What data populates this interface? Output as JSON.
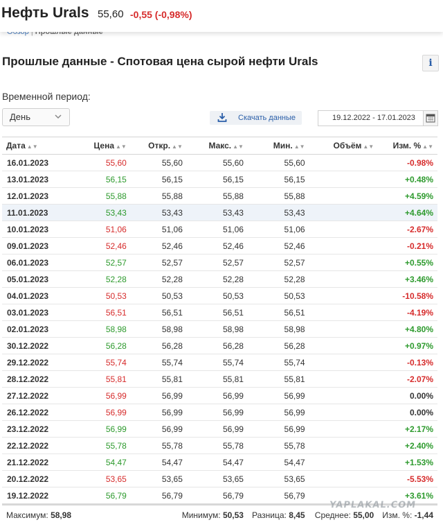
{
  "header": {
    "title": "Нефть Urals",
    "price": "55,60",
    "change": "-0,55 (-0,98%)"
  },
  "breadcrumb": {
    "overview": "Обзор",
    "separator": "|",
    "current": "Прошлые данные"
  },
  "page": {
    "heading": "Прошлые данные - Спотовая цена сырой нефти Urals",
    "info_label": "i"
  },
  "controls": {
    "period_label": "Временной период:",
    "period_value": "День",
    "download_label": "Скачать данные",
    "date_range": "19.12.2022 - 17.01.2023"
  },
  "table": {
    "columns": [
      "Дата",
      "Цена",
      "Откр.",
      "Макс.",
      "Мин.",
      "Объём",
      "Изм. %"
    ],
    "rows": [
      {
        "date": "16.01.2023",
        "price": "55,60",
        "open": "55,60",
        "high": "55,60",
        "low": "55,60",
        "volume": "",
        "change": "-0.98%",
        "dir": "down"
      },
      {
        "date": "13.01.2023",
        "price": "56,15",
        "open": "56,15",
        "high": "56,15",
        "low": "56,15",
        "volume": "",
        "change": "+0.48%",
        "dir": "up"
      },
      {
        "date": "12.01.2023",
        "price": "55,88",
        "open": "55,88",
        "high": "55,88",
        "low": "55,88",
        "volume": "",
        "change": "+4.59%",
        "dir": "up"
      },
      {
        "date": "11.01.2023",
        "price": "53,43",
        "open": "53,43",
        "high": "53,43",
        "low": "53,43",
        "volume": "",
        "change": "+4.64%",
        "dir": "up"
      },
      {
        "date": "10.01.2023",
        "price": "51,06",
        "open": "51,06",
        "high": "51,06",
        "low": "51,06",
        "volume": "",
        "change": "-2.67%",
        "dir": "down"
      },
      {
        "date": "09.01.2023",
        "price": "52,46",
        "open": "52,46",
        "high": "52,46",
        "low": "52,46",
        "volume": "",
        "change": "-0.21%",
        "dir": "down"
      },
      {
        "date": "06.01.2023",
        "price": "52,57",
        "open": "52,57",
        "high": "52,57",
        "low": "52,57",
        "volume": "",
        "change": "+0.55%",
        "dir": "up"
      },
      {
        "date": "05.01.2023",
        "price": "52,28",
        "open": "52,28",
        "high": "52,28",
        "low": "52,28",
        "volume": "",
        "change": "+3.46%",
        "dir": "up"
      },
      {
        "date": "04.01.2023",
        "price": "50,53",
        "open": "50,53",
        "high": "50,53",
        "low": "50,53",
        "volume": "",
        "change": "-10.58%",
        "dir": "down"
      },
      {
        "date": "03.01.2023",
        "price": "56,51",
        "open": "56,51",
        "high": "56,51",
        "low": "56,51",
        "volume": "",
        "change": "-4.19%",
        "dir": "down"
      },
      {
        "date": "02.01.2023",
        "price": "58,98",
        "open": "58,98",
        "high": "58,98",
        "low": "58,98",
        "volume": "",
        "change": "+4.80%",
        "dir": "up"
      },
      {
        "date": "30.12.2022",
        "price": "56,28",
        "open": "56,28",
        "high": "56,28",
        "low": "56,28",
        "volume": "",
        "change": "+0.97%",
        "dir": "up"
      },
      {
        "date": "29.12.2022",
        "price": "55,74",
        "open": "55,74",
        "high": "55,74",
        "low": "55,74",
        "volume": "",
        "change": "-0.13%",
        "dir": "down"
      },
      {
        "date": "28.12.2022",
        "price": "55,81",
        "open": "55,81",
        "high": "55,81",
        "low": "55,81",
        "volume": "",
        "change": "-2.07%",
        "dir": "down"
      },
      {
        "date": "27.12.2022",
        "price": "56,99",
        "open": "56,99",
        "high": "56,99",
        "low": "56,99",
        "volume": "",
        "change": "0.00%",
        "dir": "flat"
      },
      {
        "date": "26.12.2022",
        "price": "56,99",
        "open": "56,99",
        "high": "56,99",
        "low": "56,99",
        "volume": "",
        "change": "0.00%",
        "dir": "flat"
      },
      {
        "date": "23.12.2022",
        "price": "56,99",
        "open": "56,99",
        "high": "56,99",
        "low": "56,99",
        "volume": "",
        "change": "+2.17%",
        "dir": "up"
      },
      {
        "date": "22.12.2022",
        "price": "55,78",
        "open": "55,78",
        "high": "55,78",
        "low": "55,78",
        "volume": "",
        "change": "+2.40%",
        "dir": "up"
      },
      {
        "date": "21.12.2022",
        "price": "54,47",
        "open": "54,47",
        "high": "54,47",
        "low": "54,47",
        "volume": "",
        "change": "+1.53%",
        "dir": "up"
      },
      {
        "date": "20.12.2022",
        "price": "53,65",
        "open": "53,65",
        "high": "53,65",
        "low": "53,65",
        "volume": "",
        "change": "-5.53%",
        "dir": "down"
      },
      {
        "date": "19.12.2022",
        "price": "56,79",
        "open": "56,79",
        "high": "56,79",
        "low": "56,79",
        "volume": "",
        "change": "+3.61%",
        "dir": "up"
      }
    ],
    "highlighted_row": 3,
    "price_colors": {
      "16.01.2023": "down",
      "13.01.2023": "up",
      "12.01.2023": "up",
      "11.01.2023": "up",
      "10.01.2023": "down",
      "09.01.2023": "down",
      "06.01.2023": "up",
      "05.01.2023": "up",
      "04.01.2023": "down",
      "03.01.2023": "down",
      "02.01.2023": "up",
      "30.12.2022": "up",
      "29.12.2022": "down",
      "28.12.2022": "down",
      "27.12.2022": "down",
      "26.12.2022": "down",
      "23.12.2022": "up",
      "22.12.2022": "up",
      "21.12.2022": "up",
      "20.12.2022": "down",
      "19.12.2022": "up"
    }
  },
  "stats": {
    "max_label": "Максимум:",
    "max_value": "58,98",
    "min_label": "Минимум:",
    "min_value": "50,53",
    "diff_label": "Разница:",
    "diff_value": "8,45",
    "avg_label": "Среднее:",
    "avg_value": "55,00",
    "chg_label": "Изм. %:",
    "chg_value": "-1,44"
  },
  "watermark": "YAPLAKAL.COM",
  "colors": {
    "up": "#2d9a2d",
    "down": "#d62b2b",
    "link": "#2a5ea8",
    "highlight_row": "#eef3f9"
  },
  "icons": {
    "sort": "sort-arrows-icon",
    "download": "download-icon",
    "calendar": "calendar-icon",
    "chevron": "chevron-down-icon",
    "info": "info-icon"
  }
}
